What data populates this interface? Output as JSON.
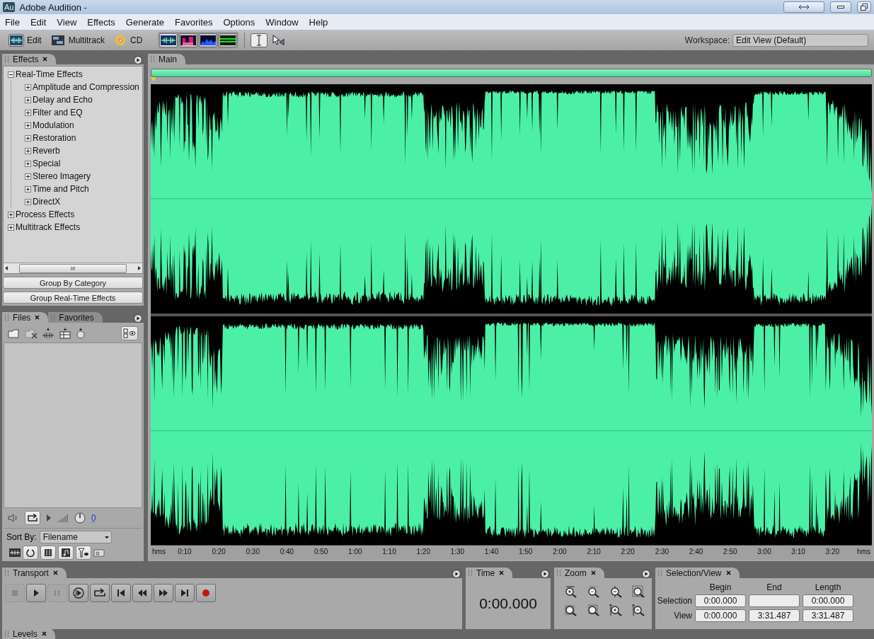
{
  "window": {
    "app_icon": "Au",
    "title": "Adobe Audition -"
  },
  "menu": [
    "File",
    "Edit",
    "View",
    "Effects",
    "Generate",
    "Favorites",
    "Options",
    "Window",
    "Help"
  ],
  "toolbar": {
    "views": [
      {
        "kind": "edit",
        "label": "Edit",
        "selected": true
      },
      {
        "kind": "multitrack",
        "label": "Multitrack",
        "selected": false
      },
      {
        "kind": "cd",
        "label": "CD",
        "selected": false
      }
    ],
    "display_modes": [
      {
        "kind": "waveform",
        "selected": true
      },
      {
        "kind": "spectral",
        "selected": false
      },
      {
        "kind": "pitch",
        "selected": false
      },
      {
        "kind": "phase",
        "selected": false
      }
    ],
    "tools": [
      {
        "kind": "time-selection",
        "selected": true
      },
      {
        "kind": "move",
        "selected": false
      }
    ],
    "workspace_label": "Workspace:",
    "workspace": "Edit View (Default)"
  },
  "effects_panel": {
    "tab": "Effects",
    "tree": [
      {
        "label": "Real-Time Effects",
        "expanded": true,
        "children": [
          {
            "label": "Amplitude and Compression",
            "expanded": false
          },
          {
            "label": "Delay and Echo",
            "expanded": false
          },
          {
            "label": "Filter and EQ",
            "expanded": false
          },
          {
            "label": "Modulation",
            "expanded": false
          },
          {
            "label": "Restoration",
            "expanded": false
          },
          {
            "label": "Reverb",
            "expanded": false
          },
          {
            "label": "Special",
            "expanded": false
          },
          {
            "label": "Stereo Imagery",
            "expanded": false
          },
          {
            "label": "Time and Pitch",
            "expanded": false
          },
          {
            "label": "DirectX",
            "expanded": false
          }
        ]
      },
      {
        "label": "Process Effects",
        "expanded": false
      },
      {
        "label": "Multitrack Effects",
        "expanded": false
      }
    ],
    "scroll_thumb": "III",
    "buttons": [
      "Group By Category",
      "Group Real-Time Effects"
    ]
  },
  "files_panel": {
    "tabs": [
      {
        "label": "Files",
        "selected": true
      },
      {
        "label": "Favorites",
        "selected": false
      }
    ],
    "volume_value": "0",
    "sort_label": "Sort By:",
    "sort_value": "Filename"
  },
  "editor": {
    "tab": "Main",
    "ruler": [
      "hms",
      "0:10",
      "0:20",
      "0:30",
      "0:40",
      "0:50",
      "1:00",
      "1:10",
      "1:20",
      "1:30",
      "1:40",
      "1:50",
      "2:00",
      "2:10",
      "2:20",
      "2:30",
      "2:40",
      "2:50",
      "3:00",
      "3:10",
      "3:20",
      "hms"
    ]
  },
  "transport": {
    "tab": "Transport",
    "buttons": [
      {
        "kind": "stop",
        "disabled": true
      },
      {
        "kind": "play",
        "disabled": false
      },
      {
        "kind": "pause",
        "disabled": true
      },
      {
        "kind": "play-from-cursor",
        "disabled": false
      },
      {
        "kind": "loop",
        "disabled": false
      },
      {
        "kind": "to-start",
        "disabled": false
      },
      {
        "kind": "rewind",
        "disabled": false
      },
      {
        "kind": "forward",
        "disabled": false
      },
      {
        "kind": "to-end",
        "disabled": false
      },
      {
        "kind": "record",
        "disabled": false
      }
    ]
  },
  "time": {
    "tab": "Time",
    "value": "0:00.000"
  },
  "zoom": {
    "tab": "Zoom"
  },
  "selection_view": {
    "tab": "Selection/View",
    "columns": [
      "Begin",
      "End",
      "Length"
    ],
    "rows": [
      {
        "label": "Selection",
        "begin": "0:00.000",
        "length": "0:00.000"
      },
      {
        "label": "View",
        "begin": "0:00.000",
        "end": "3:31.487",
        "length": "3:31.487"
      }
    ]
  },
  "levels": {
    "tab": "Levels"
  }
}
